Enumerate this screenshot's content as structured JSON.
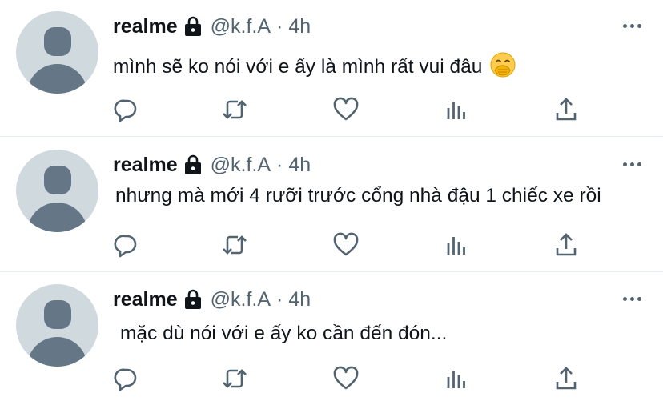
{
  "tweets": [
    {
      "author_name": "realme",
      "handle": "@k.f.A",
      "separator": "·",
      "time": "4h",
      "text": "mình sẽ ko nói với e ấy là mình rất vui đâu",
      "emoji": "face-with-hand-over-mouth"
    },
    {
      "author_name": "realme",
      "handle": "@k.f.A",
      "separator": "·",
      "time": "4h",
      "text": "nhưng mà mới 4 rưỡi trước cổng nhà đậu 1 chiếc xe rồi"
    },
    {
      "author_name": "realme",
      "handle": "@k.f.A",
      "separator": "·",
      "time": "4h",
      "text": "mặc dù nói với e ấy ko cần đến đón..."
    }
  ],
  "icons": {
    "reply": "reply-icon",
    "retweet": "retweet-icon",
    "like": "like-icon",
    "views": "views-icon",
    "share": "share-icon",
    "lock": "lock-icon",
    "more": "more-icon"
  },
  "colors": {
    "icon_gray": "#536471",
    "avatar_bg": "#cfd9de",
    "avatar_fg": "#657786",
    "divider": "#e6ecf0"
  }
}
